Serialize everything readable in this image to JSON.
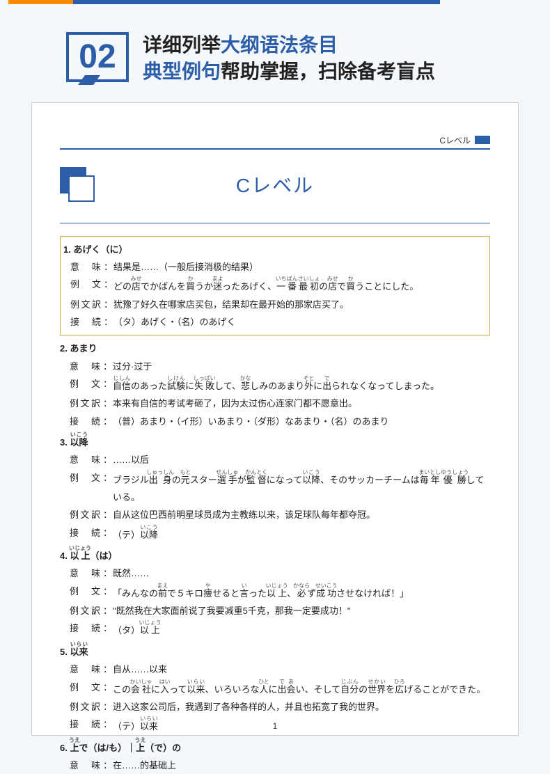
{
  "top": {
    "badge": "02"
  },
  "title": {
    "line1a": "详细列举",
    "line1b": "大纲语法条目",
    "line2a": "典型例句",
    "line2b": "帮助掌握，扫除备考盲点"
  },
  "page": {
    "tab": "Cレベル",
    "header": "Cレベル",
    "pageNum": "1"
  },
  "labels": {
    "imi": "意　味",
    "rei": "例　文",
    "yaku": "例文訳",
    "setsu": "接　続",
    "colon": "："
  },
  "e1": {
    "title": "1. あげく（に）",
    "imi": "结果是……（一般后接消极的结果）",
    "rei": "どの<ruby>店<rt>みせ</rt></ruby>でかばんを<ruby>買<rt>か</rt></ruby>うか<ruby>迷<rt>まよ</rt></ruby>ったあげく、<ruby>一番最初<rt>いちばんさいしょ</rt></ruby>の<ruby>店<rt>みせ</rt></ruby>で<ruby>買<rt>か</rt></ruby>うことにした。",
    "yaku": "犹豫了好久在哪家店买包，结果却在最开始的那家店买了。",
    "setsu": "（タ）あげく・（名）のあげく"
  },
  "e2": {
    "title": "2. あまり",
    "imi": "过分·过于",
    "rei": "<ruby>自信<rt>じしん</rt></ruby>のあった<ruby>試験<rt>しけん</rt></ruby>に<ruby>失敗<rt>しっぱい</rt></ruby>して、<ruby>悲<rt>かな</rt></ruby>しみのあまり<ruby>外<rt>そと</rt></ruby>に<ruby>出<rt>で</rt></ruby>られなくなってしまった。",
    "yaku": "本来有自信的考试考砸了，因为太过伤心连家门都不愿意出。",
    "setsu": "（普）あまり・（イ形）いあまり・（ダ形）なあまり・（名）のあまり"
  },
  "e3": {
    "title": "3. <ruby>以降<rt>いこう</rt></ruby>",
    "imi": "……以后",
    "rei": "ブラジル<ruby>出身<rt>しゅっしん</rt></ruby>の<ruby>元<rt>もと</rt></ruby>スター<ruby>選手<rt>せんしゅ</rt></ruby>が<ruby>監督<rt>かんとく</rt></ruby>になって<ruby>以降<rt>いこう</rt></ruby>、そのサッカーチームは<ruby>毎<rt>まい</rt></ruby><ruby>年<rt>とし</rt></ruby><ruby>優勝<rt>ゆうしょう</rt></ruby>している。",
    "yaku": "自从这位巴西前明星球员成为主教练以来，该足球队每年都夺冠。",
    "setsu": "（テ）<ruby>以降<rt>いこう</rt></ruby>"
  },
  "e4": {
    "title": "4. <ruby>以上<rt>いじょう</rt></ruby>（は）",
    "imi": "既然……",
    "rei": "「みんなの<ruby>前<rt>まえ</rt></ruby>で５キロ<ruby>痩<rt>や</rt></ruby>せると<ruby>言<rt>い</rt></ruby>った<ruby>以上<rt>いじょう</rt></ruby>、<ruby>必<rt>かなら</rt></ruby>ず<ruby>成功<rt>せいこう</rt></ruby>させなければ！」",
    "yaku": "\"既然我在大家面前说了我要减重5千克，那我一定要成功！\"",
    "setsu": "（タ）<ruby>以上<rt>いじょう</rt></ruby>"
  },
  "e5": {
    "title": "5. <ruby>以来<rt>いらい</rt></ruby>",
    "imi": "自从……以来",
    "rei": "この<ruby>会社<rt>かいしゃ</rt></ruby>に<ruby>入<rt>はい</rt></ruby>って<ruby>以来<rt>いらい</rt></ruby>、いろいろな<ruby>人<rt>ひと</rt></ruby>に<ruby>出会<rt>であ</rt></ruby>い、そして<ruby>自分<rt>じぶん</rt></ruby>の<ruby>世界<rt>せかい</rt></ruby>を<ruby>広<rt>ひろ</rt></ruby>げることができた。",
    "yaku": "进入这家公司后，我遇到了各种各样的人，并且也拓宽了我的世界。",
    "setsu": "（テ）<ruby>以来<rt>いらい</rt></ruby>"
  },
  "e6": {
    "title": "6. <ruby>上<rt>うえ</rt></ruby>で（は/も）｜<ruby>上<rt>うえ</rt></ruby>（で）の",
    "imi": "在……的基础上"
  }
}
